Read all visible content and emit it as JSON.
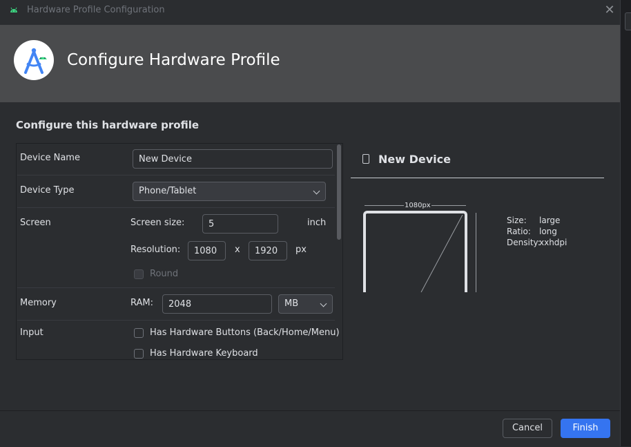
{
  "window": {
    "title": "Hardware Profile Configuration",
    "close_icon": "close-icon"
  },
  "header": {
    "title": "Configure Hardware Profile",
    "logo_icon": "android-studio-logo"
  },
  "section": {
    "title": "Configure this hardware profile"
  },
  "form": {
    "device_name": {
      "label": "Device Name",
      "value": "New Device"
    },
    "device_type": {
      "label": "Device Type",
      "selected": "Phone/Tablet"
    },
    "screen": {
      "label": "Screen",
      "size_label": "Screen size:",
      "size_value": "5",
      "size_unit": "inch",
      "resolution_label": "Resolution:",
      "res_width": "1080",
      "res_sep": "x",
      "res_height": "1920",
      "res_unit": "px",
      "round_label": "Round",
      "round_checked": false
    },
    "memory": {
      "label": "Memory",
      "ram_label": "RAM:",
      "ram_value": "2048",
      "ram_unit": "MB"
    },
    "input": {
      "label": "Input",
      "hw_buttons_label": "Has Hardware Buttons (Back/Home/Menu)",
      "hw_buttons_checked": false,
      "hw_keyboard_label": "Has Hardware Keyboard",
      "hw_keyboard_checked": false
    }
  },
  "preview": {
    "title": "New Device",
    "device_icon": "phone-icon",
    "width_label": "1080px",
    "size_key": "Size:",
    "size_val": "large",
    "ratio_key": "Ratio:",
    "ratio_val": "long",
    "density_key": "Density:",
    "density_val": "xxhdpi"
  },
  "footer": {
    "cancel_label": "Cancel",
    "finish_label": "Finish"
  },
  "colors": {
    "background": "#2b2d30",
    "header": "#4a4b4d",
    "accent": "#3574f0",
    "text": "#dfe1e5"
  }
}
